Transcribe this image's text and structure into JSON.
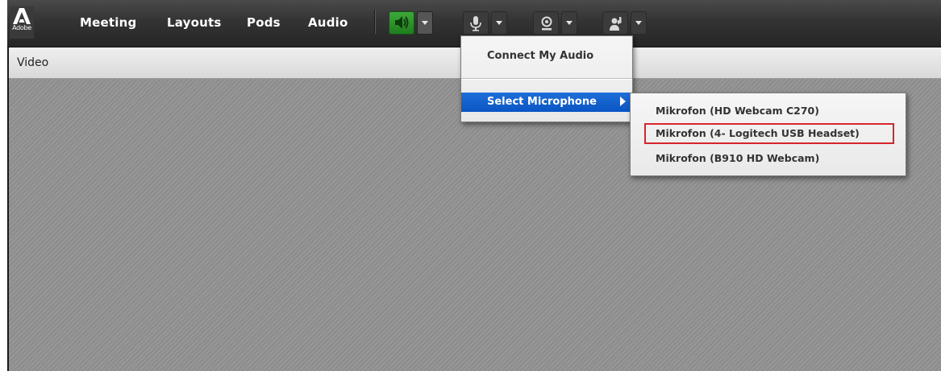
{
  "app": {
    "logo_text": "Adobe"
  },
  "menubar": {
    "items": [
      {
        "label": "Meeting"
      },
      {
        "label": "Layouts"
      },
      {
        "label": "Pods"
      },
      {
        "label": "Audio"
      }
    ],
    "tools": [
      {
        "icon": "speaker-icon",
        "state": "active"
      },
      {
        "icon": "microphone-icon"
      },
      {
        "icon": "webcam-icon"
      },
      {
        "icon": "raise-hand-icon"
      }
    ]
  },
  "pod": {
    "title": "Video"
  },
  "audio_menu": {
    "items": [
      {
        "label": "Connect My Audio"
      },
      {
        "label": "Select Microphone",
        "selected": true,
        "has_submenu": true
      }
    ]
  },
  "microphone_submenu": {
    "items": [
      {
        "label": "Mikrofon (HD Webcam C270)"
      },
      {
        "label": "Mikrofon (4- Logitech USB Headset)",
        "highlighted": true
      },
      {
        "label": "Mikrofon (B910 HD Webcam)"
      }
    ],
    "highlight_color": "#d6252b"
  },
  "colors": {
    "menubar": "#333333",
    "speaker_active": "#2e9a2b",
    "menu_selection": "#1565d4"
  }
}
